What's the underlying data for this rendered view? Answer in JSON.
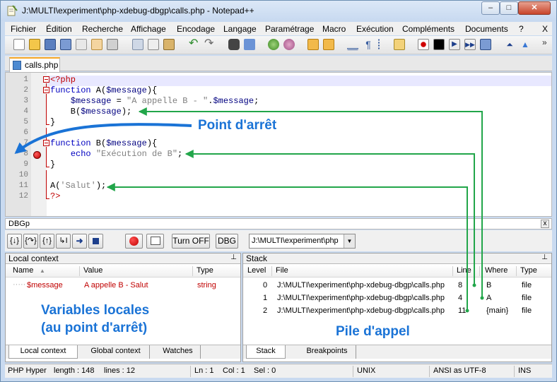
{
  "window": {
    "title": "J:\\MULTI\\experiment\\php-xdebug-dbgp\\calls.php - Notepad++",
    "controls": {
      "minimize": "–",
      "maximize": "□",
      "close": "✕"
    }
  },
  "menu": [
    "Fichier",
    "Édition",
    "Recherche",
    "Affichage",
    "Encodage",
    "Langage",
    "Paramétrage",
    "Macro",
    "Exécution",
    "Compléments",
    "Documents",
    "?",
    "X"
  ],
  "toolbar": {
    "icons": [
      "new-file-icon",
      "open-file-icon",
      "save-icon",
      "save-all-icon",
      "close-icon",
      "close-all-icon",
      "print-icon",
      "cut-icon",
      "copy-icon",
      "paste-icon",
      "undo-icon",
      "redo-icon",
      "find-icon",
      "replace-icon",
      "zoom-in-icon",
      "zoom-out-icon",
      "sync-v-icon",
      "sync-h-icon",
      "word-wrap-icon",
      "show-all-chars-icon",
      "indent-guide-icon",
      "fold-icon",
      "record-macro-icon",
      "stop-macro-icon",
      "play-macro-icon",
      "run-multiple-icon",
      "save-macro-icon",
      "up-icon",
      "triangle-icon"
    ],
    "overflow": "»"
  },
  "tab": {
    "label": "calls.php"
  },
  "editor": {
    "lines": [
      {
        "n": "1",
        "html": "<span class='p'>&lt;?php</span>"
      },
      {
        "n": "2",
        "html": "<span class='k'>function</span> A(<span class='v'>$message</span>){"
      },
      {
        "n": "3",
        "html": "    <span class='v'>$message</span> = <span class='s'>\"A appelle B - \"</span>.<span class='v'>$message</span>;"
      },
      {
        "n": "4",
        "html": "    B(<span class='v'>$message</span>);"
      },
      {
        "n": "5",
        "html": "}"
      },
      {
        "n": "6",
        "html": ""
      },
      {
        "n": "7",
        "html": "<span class='k'>function</span> B(<span class='v'>$message</span>){"
      },
      {
        "n": "8",
        "html": "    <span class='k'>echo</span> <span class='s'>\"Exécution de B\"</span>;"
      },
      {
        "n": "9",
        "html": "}"
      },
      {
        "n": "10",
        "html": ""
      },
      {
        "n": "11",
        "html": "A(<span class='s'>'Salut'</span>);"
      },
      {
        "n": "12",
        "html": "<span class='p'>?&gt;</span>"
      }
    ]
  },
  "annotations": {
    "breakpoint": "Point d'arrêt",
    "locals": "Variables locales",
    "locals2": "(au point d'arrêt)",
    "stack": "Pile d'appel"
  },
  "dbgp": {
    "title": "DBGp",
    "close": "x",
    "step_icons": [
      "step-into-icon",
      "step-over-icon",
      "step-out-icon",
      "run-to-cursor-icon",
      "run-icon",
      "stop-icon"
    ],
    "turn_off": "Turn OFF",
    "dbg": "DBG",
    "path": "J:\\MULTI\\experiment\\php"
  },
  "local_context": {
    "title": "Local context",
    "pin": "📌",
    "columns": [
      "Name",
      "Value",
      "Type"
    ],
    "rows": [
      {
        "name": "$message",
        "value": "A appelle B - Salut",
        "type": "string"
      }
    ],
    "tabs": [
      "Local context",
      "Global context",
      "Watches"
    ]
  },
  "stack": {
    "title": "Stack",
    "pin": "📌",
    "columns": [
      "Level",
      "File",
      "Line",
      "Where",
      "Type"
    ],
    "rows": [
      {
        "level": "0",
        "file": "J:\\MULTI\\experiment\\php-xdebug-dbgp\\calls.php",
        "line": "8",
        "where": "B",
        "type": "file"
      },
      {
        "level": "1",
        "file": "J:\\MULTI\\experiment\\php-xdebug-dbgp\\calls.php",
        "line": "4",
        "where": "A",
        "type": "file"
      },
      {
        "level": "2",
        "file": "J:\\MULTI\\experiment\\php-xdebug-dbgp\\calls.php",
        "line": "11",
        "where": "{main}",
        "type": "file"
      }
    ],
    "tabs": [
      "Stack",
      "Breakpoints"
    ]
  },
  "status": {
    "lang": "PHP Hyper",
    "length": "length : 148",
    "lines": "lines : 12",
    "ln": "Ln : 1",
    "col": "Col : 1",
    "sel": "Sel : 0",
    "eol": "UNIX",
    "enc": "ANSI as UTF-8",
    "ins": "INS"
  },
  "colors": {
    "accent": "#1a73d6",
    "arrow_green": "#22a64a",
    "breakpoint": "#c00000"
  }
}
